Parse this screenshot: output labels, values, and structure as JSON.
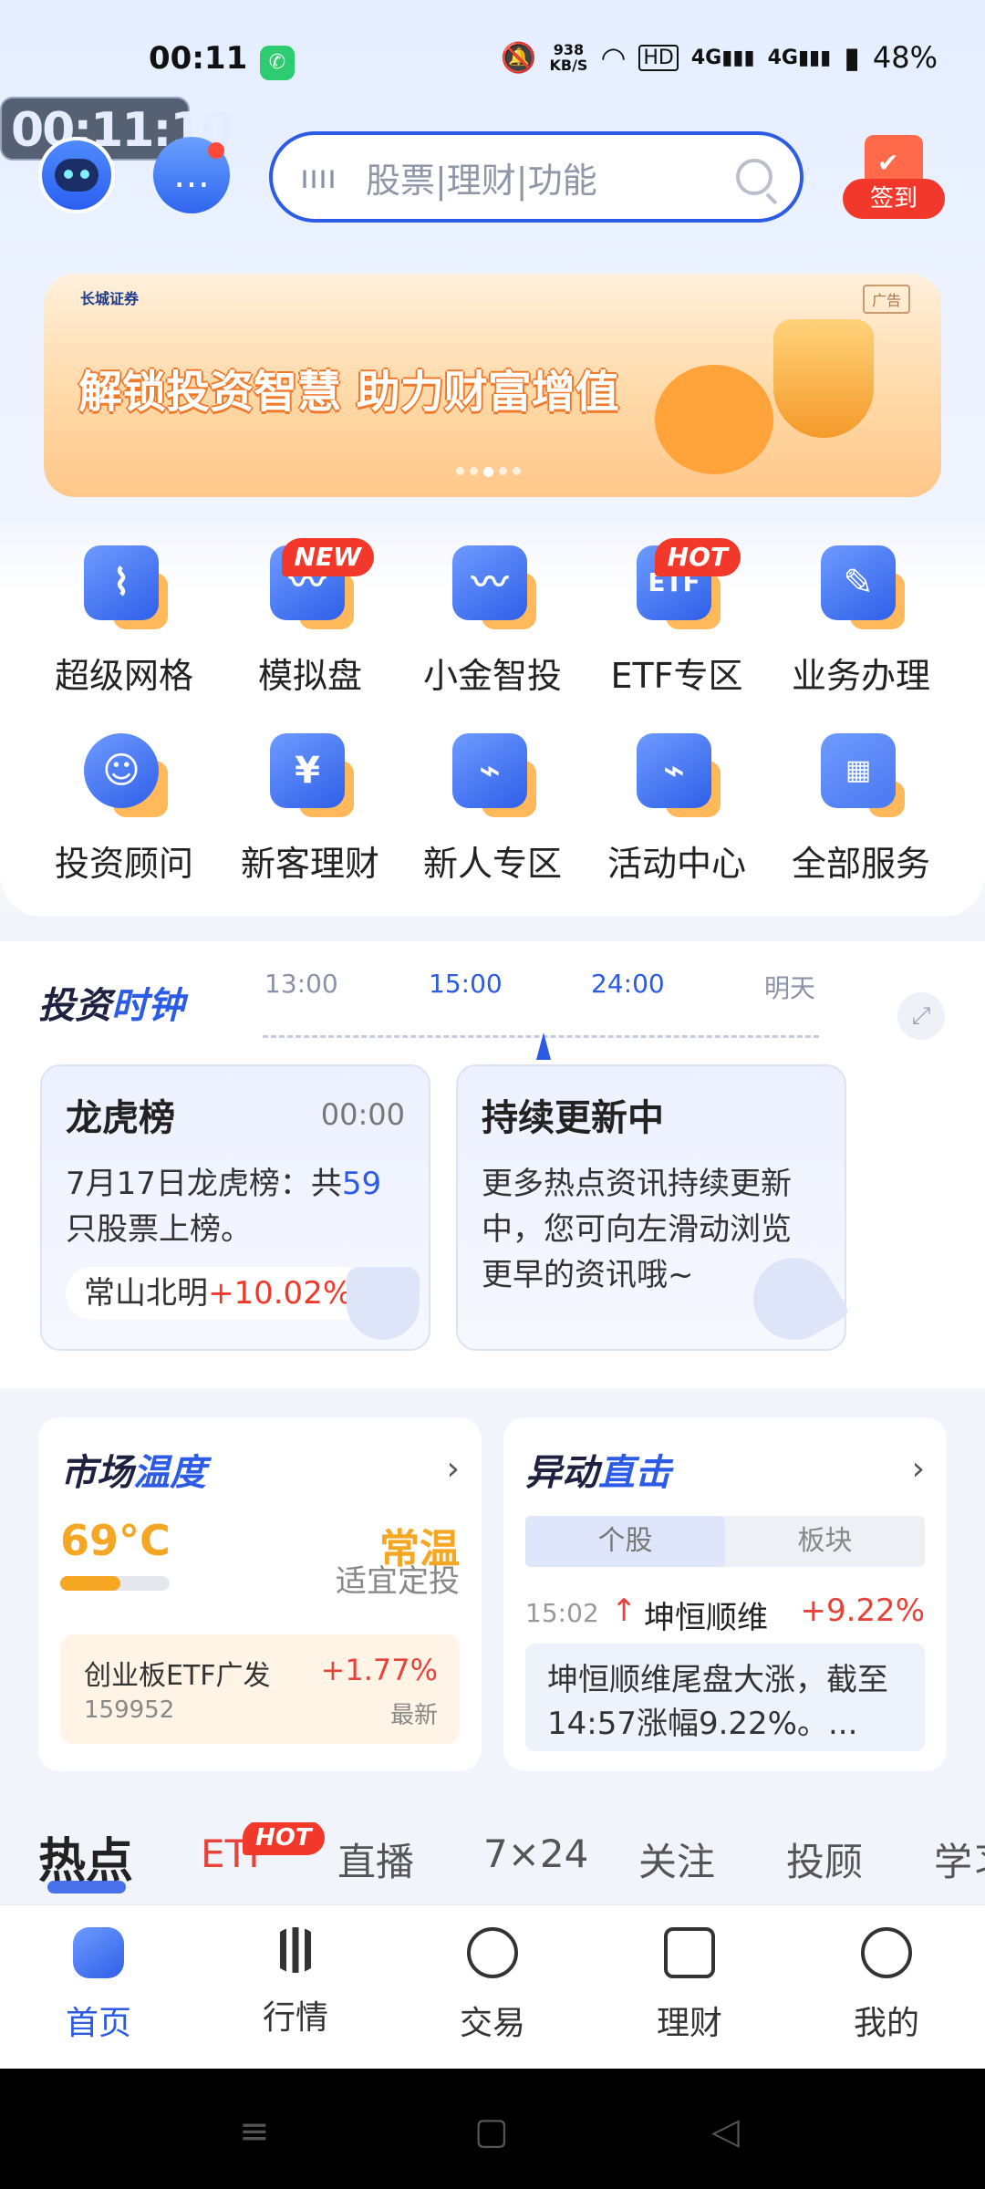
{
  "status": {
    "time": "00:11",
    "speed_value": "938",
    "speed_unit": "KB/S",
    "hd": "HD",
    "net1": "4G",
    "net2": "4G",
    "battery": "48%",
    "overlay_timer": "00:11:10"
  },
  "search": {
    "placeholder": "股票|理财|功能"
  },
  "checkin": {
    "label": "签到"
  },
  "banner": {
    "logo": "长城证券",
    "ad": "广告",
    "slogan": "解锁投资智慧 助力财富增值",
    "slide_count": 5,
    "active_slide": 3
  },
  "services": [
    {
      "label": "超级网格",
      "icon": "grid-chart-icon",
      "tag": ""
    },
    {
      "label": "模拟盘",
      "icon": "monitor-pulse-icon",
      "tag": "NEW"
    },
    {
      "label": "小金智投",
      "icon": "owl-pulse-icon",
      "tag": ""
    },
    {
      "label": "ETF专区",
      "icon": "etf-icon",
      "tag": "HOT"
    },
    {
      "label": "业务办理",
      "icon": "edit-icon",
      "tag": ""
    },
    {
      "label": "投资顾问",
      "icon": "advisor-icon",
      "tag": ""
    },
    {
      "label": "新客理财",
      "icon": "yen-icon",
      "tag": ""
    },
    {
      "label": "新人专区",
      "icon": "ticket-icon",
      "tag": ""
    },
    {
      "label": "活动中心",
      "icon": "calendar-icon",
      "tag": ""
    },
    {
      "label": "全部服务",
      "icon": "apps-icon",
      "tag": ""
    }
  ],
  "clock": {
    "title_a": "投资",
    "title_b": "时钟",
    "times": [
      "13:00",
      "15:00",
      "24:00",
      "明天"
    ],
    "active_times": [
      "15:00",
      "24:00"
    ],
    "cards": [
      {
        "title": "龙虎榜",
        "time": "00:00",
        "body_a": "7月17日龙虎榜：共",
        "body_num": "59",
        "body_b": "只股票上榜。",
        "pill_name": "常山北明",
        "pill_pct": "+10.02%"
      },
      {
        "title": "持续更新中",
        "body": "更多热点资讯持续更新中，您可向左滑动浏览更早的资讯哦~"
      }
    ]
  },
  "market_temp": {
    "title_a": "市场",
    "title_b": "温度",
    "value": "69°C",
    "level": "常温",
    "advice": "适宜定投",
    "level_fraction": 0.55,
    "etf": {
      "name": "创业板ETF广发",
      "code": "159952",
      "change": "+1.77%",
      "note": "最新"
    }
  },
  "movement": {
    "title_a": "异动",
    "title_b": "直击",
    "tabs": [
      "个股",
      "板块"
    ],
    "active_tab": "个股",
    "item": {
      "time": "15:02",
      "name": "坤恒顺维",
      "change": "+9.22%",
      "desc": "坤恒顺维尾盘大涨，截至14:57涨幅9.22%。..."
    }
  },
  "feed_tabs": {
    "items": [
      "热点",
      "ETF",
      "直播",
      "7×24",
      "关注",
      "投顾",
      "学习"
    ],
    "active": "热点",
    "hot_tag": "HOT"
  },
  "bottom_nav": {
    "items": [
      "首页",
      "行情",
      "交易",
      "理财",
      "我的"
    ],
    "active": "首页"
  },
  "colors": {
    "accent": "#2c5be6",
    "up": "#e8433a",
    "warm": "#f5a623",
    "tag": "#f2382a"
  }
}
